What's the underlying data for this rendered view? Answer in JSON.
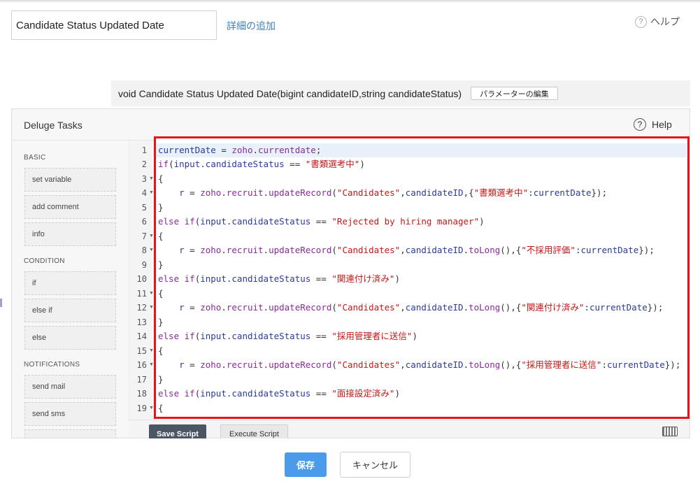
{
  "header": {
    "function_name_value": "Candidate Status Updated Date",
    "add_details_label": "詳細の追加",
    "help_label": "ヘルプ",
    "help_icon": "?"
  },
  "signature": {
    "text": "void Candidate Status Updated Date(bigint candidateID,string candidateStatus)",
    "edit_params_label": "パラメーターの編集"
  },
  "panel": {
    "title": "Deluge Tasks",
    "help_label": "Help",
    "help_icon": "?"
  },
  "sidebar": {
    "sections": {
      "basic": "BASIC",
      "condition": "CONDITION",
      "notifications": "NOTIFICATIONS"
    },
    "tasks": {
      "set_variable": "set variable",
      "add_comment": "add comment",
      "info": "info",
      "if": "if",
      "else_if": "else if",
      "else": "else",
      "send_mail": "send mail",
      "send_sms": "send sms"
    }
  },
  "code": {
    "line_numbers": [
      "1",
      "2",
      "3",
      "4",
      "5",
      "6",
      "7",
      "8",
      "9",
      "10",
      "11",
      "12",
      "13",
      "14",
      "15",
      "16",
      "17",
      "18",
      "19"
    ],
    "fold_marker": "▼",
    "t": {
      "currentDate": "currentDate",
      "eq_assign": " = ",
      "zoho": "zoho",
      "dot": ".",
      "currentdate_fn": "currentdate",
      "semicolon": ";",
      "if_kw": "if",
      "else_if_kw": "else if",
      "open_paren": "(",
      "close_paren": ")",
      "input": "input",
      "candidateStatus": "candidateStatus",
      "eqeq": " == ",
      "open_brace": "{",
      "close_brace": "}",
      "indent": "    ",
      "r": "r",
      "recruit": "recruit",
      "updateRecord": "updateRecord",
      "candidates_str": "\"Candidates\"",
      "comma": ",",
      "candidateID": "candidateID",
      "toLong": "toLong",
      "call_end": "()",
      "map_open": "{",
      "colon": ":",
      "map_close_end": "});"
    },
    "status_strings": {
      "s1": "\"書類選考中\"",
      "s2": "\"Rejected by hiring manager\"",
      "s3": "\"関連付け済み\"",
      "s4": "\"採用管理者に送信\"",
      "s5": "\"面接設定済み\""
    },
    "field_strings": {
      "f1": "\"書類選考中\"",
      "f2": "\"不採用評価\"",
      "f3": "\"関連付け済み\"",
      "f4": "\"採用管理者に送信\""
    }
  },
  "editor_footer": {
    "save_script_label": "Save Script",
    "execute_script_label": "Execute Script"
  },
  "actions": {
    "save_label": "保存",
    "cancel_label": "キャンセル"
  },
  "colors": {
    "highlight_border": "#e3151b",
    "primary_button": "#4a9bea",
    "link": "#3f7fc1",
    "keyword": "#8a2a9a",
    "string": "#c21818",
    "variable": "#2b3a9a"
  }
}
